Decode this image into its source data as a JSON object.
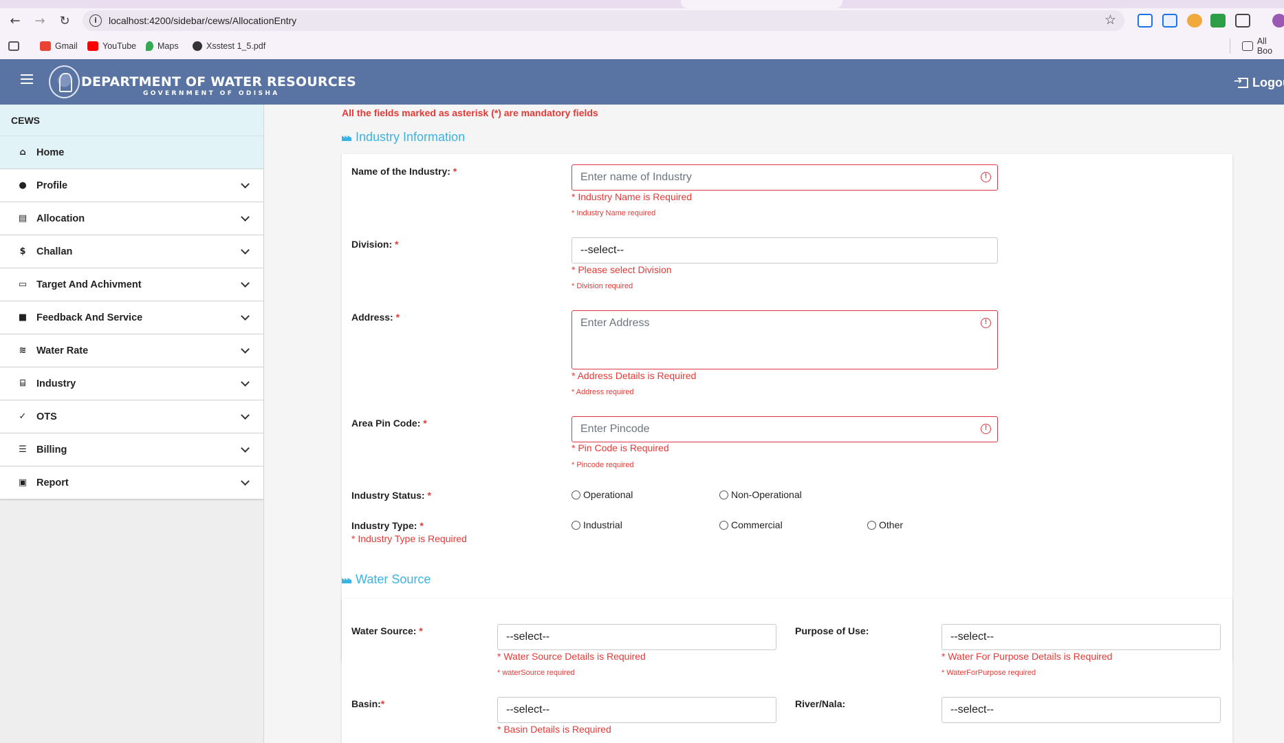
{
  "browser": {
    "url": "localhost:4200/sidebar/cews/AllocationEntry",
    "bookmarks": [
      "Gmail",
      "YouTube",
      "Maps",
      "Xsstest 1_5.pdf"
    ],
    "all_bookmarks": "All Boo"
  },
  "header": {
    "title": "DEPARTMENT OF WATER RESOURCES",
    "subtitle": "GOVERNMENT OF ODISHA",
    "logout": "Logou"
  },
  "sidebar": {
    "title": "CEWS",
    "home": "Home",
    "items": [
      {
        "label": "Profile",
        "icon": "account-circle-icon"
      },
      {
        "label": "Allocation",
        "icon": "note-add-icon"
      },
      {
        "label": "Challan",
        "icon": "dollar-icon"
      },
      {
        "label": "Target And Achivment",
        "icon": "inbox-icon"
      },
      {
        "label": "Feedback And Service",
        "icon": "feedback-icon"
      },
      {
        "label": "Water Rate",
        "icon": "waves-icon"
      },
      {
        "label": "Industry",
        "icon": "bank-icon"
      },
      {
        "label": "OTS",
        "icon": "check-icon"
      },
      {
        "label": "Billing",
        "icon": "list-icon"
      },
      {
        "label": "Report",
        "icon": "library-books-icon"
      }
    ]
  },
  "form": {
    "mandatory_note": "All the fields marked as asterisk (*) are mandatory fields",
    "industry_section": "Industry Information",
    "industry_name": {
      "label": "Name of the Industry:",
      "placeholder": "Enter name of Industry",
      "error": "* Industry Name is Required",
      "error_small": "* Industry Name required"
    },
    "division": {
      "label": "Division:",
      "value": "--select--",
      "error": "* Please select Division",
      "error_small": "* Division required"
    },
    "address": {
      "label": "Address:",
      "placeholder": "Enter Address",
      "error": "* Address Details is Required",
      "error_small": "* Address required"
    },
    "pincode": {
      "label": "Area Pin Code:",
      "placeholder": "Enter Pincode",
      "error": "* Pin Code is Required",
      "error_small": "* Pincode required"
    },
    "industry_status": {
      "label": "Industry Status:",
      "options": [
        "Operational",
        "Non-Operational"
      ]
    },
    "industry_type": {
      "label": "Industry Type:",
      "options": [
        "Industrial",
        "Commercial",
        "Other"
      ],
      "error": "* Industry Type is Required"
    },
    "water_section": "Water Source",
    "water_source": {
      "label": "Water Source:",
      "value": "--select--",
      "error": "* Water Source Details is Required",
      "error_small": "* waterSource required"
    },
    "purpose": {
      "label": "Purpose of Use:",
      "value": "--select--",
      "error": "* Water For Purpose Details is Required",
      "error_small": "* WaterForPurpose required"
    },
    "basin": {
      "label": "Basin:",
      "value": "--select--",
      "error": "* Basin Details is Required"
    },
    "river": {
      "label": "River/Nala:",
      "value": "--select--"
    }
  },
  "colors": {
    "header_bg": "#5974a3",
    "error_red": "#e53935",
    "section_blue": "#38b4e4"
  }
}
